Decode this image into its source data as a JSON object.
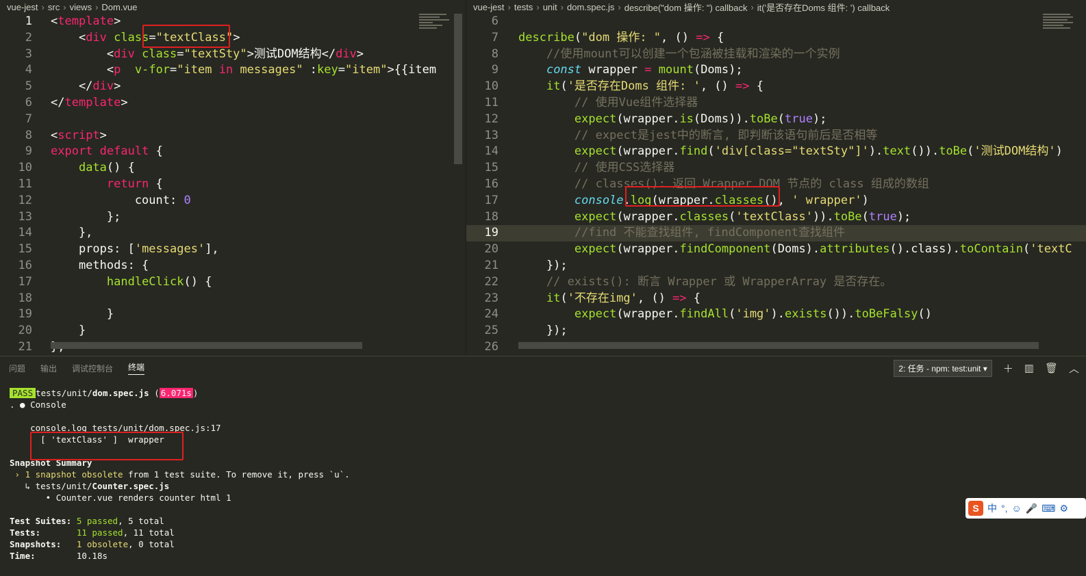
{
  "left_editor": {
    "breadcrumb": [
      "vue-jest",
      "src",
      "views",
      "Dom.vue"
    ],
    "lines": [
      {
        "n": "1",
        "cur": true,
        "parts": [
          [
            "pun",
            "<"
          ],
          [
            "tag",
            "template"
          ],
          [
            "pun",
            ">"
          ]
        ]
      },
      {
        "n": "2",
        "parts": [
          [
            "pun",
            "    <"
          ],
          [
            "tag",
            "div"
          ],
          [
            "pun",
            " "
          ],
          [
            "att",
            "class"
          ],
          [
            "pun",
            "="
          ],
          [
            "str",
            "\"textClass\""
          ],
          [
            "pun",
            ">"
          ]
        ]
      },
      {
        "n": "3",
        "parts": [
          [
            "pun",
            "        <"
          ],
          [
            "tag",
            "div"
          ],
          [
            "pun",
            " "
          ],
          [
            "att",
            "class"
          ],
          [
            "pun",
            "="
          ],
          [
            "str",
            "\"textSty\""
          ],
          [
            "pun",
            ">测试DOM结构</"
          ],
          [
            "tag",
            "div"
          ],
          [
            "pun",
            ">"
          ]
        ]
      },
      {
        "n": "4",
        "parts": [
          [
            "pun",
            "        <"
          ],
          [
            "tag",
            "p"
          ],
          [
            "pun",
            "  "
          ],
          [
            "att",
            "v-for"
          ],
          [
            "pun",
            "="
          ],
          [
            "str",
            "\"item "
          ],
          [
            "kw",
            "in"
          ],
          [
            "str",
            " messages\""
          ],
          [
            "pun",
            " :"
          ],
          [
            "att",
            "key"
          ],
          [
            "pun",
            "="
          ],
          [
            "str",
            "\"item\""
          ],
          [
            "pun",
            ">{{item"
          ]
        ]
      },
      {
        "n": "5",
        "parts": [
          [
            "pun",
            "    </"
          ],
          [
            "tag",
            "div"
          ],
          [
            "pun",
            ">"
          ]
        ]
      },
      {
        "n": "6",
        "parts": [
          [
            "pun",
            "</"
          ],
          [
            "tag",
            "template"
          ],
          [
            "pun",
            ">"
          ]
        ]
      },
      {
        "n": "7",
        "parts": []
      },
      {
        "n": "8",
        "parts": [
          [
            "pun",
            "<"
          ],
          [
            "tag",
            "script"
          ],
          [
            "pun",
            ">"
          ]
        ]
      },
      {
        "n": "9",
        "parts": [
          [
            "kw",
            "export"
          ],
          [
            "pun",
            " "
          ],
          [
            "kw",
            "default"
          ],
          [
            "pun",
            " {"
          ]
        ]
      },
      {
        "n": "10",
        "parts": [
          [
            "pun",
            "    "
          ],
          [
            "fn",
            "data"
          ],
          [
            "pun",
            "() {"
          ]
        ]
      },
      {
        "n": "11",
        "parts": [
          [
            "pun",
            "        "
          ],
          [
            "kw",
            "return"
          ],
          [
            "pun",
            " {"
          ]
        ]
      },
      {
        "n": "12",
        "parts": [
          [
            "pun",
            "            count: "
          ],
          [
            "num",
            "0"
          ]
        ]
      },
      {
        "n": "13",
        "parts": [
          [
            "pun",
            "        };"
          ]
        ]
      },
      {
        "n": "14",
        "parts": [
          [
            "pun",
            "    },"
          ]
        ]
      },
      {
        "n": "15",
        "parts": [
          [
            "pun",
            "    props: ["
          ],
          [
            "str",
            "'messages'"
          ],
          [
            "pun",
            "],"
          ]
        ]
      },
      {
        "n": "16",
        "parts": [
          [
            "pun",
            "    methods: {"
          ]
        ]
      },
      {
        "n": "17",
        "parts": [
          [
            "pun",
            "        "
          ],
          [
            "fn",
            "handleClick"
          ],
          [
            "pun",
            "() {"
          ]
        ]
      },
      {
        "n": "18",
        "parts": []
      },
      {
        "n": "19",
        "parts": [
          [
            "pun",
            "        }"
          ]
        ]
      },
      {
        "n": "20",
        "parts": [
          [
            "pun",
            "    }"
          ]
        ]
      },
      {
        "n": "21",
        "parts": [
          [
            "pun",
            "};"
          ]
        ]
      }
    ]
  },
  "right_editor": {
    "breadcrumb": [
      "vue-jest",
      "tests",
      "unit",
      "dom.spec.js",
      "describe(\"dom 操作: \") callback",
      "it('是否存在Doms 组件: ') callback"
    ],
    "lines": [
      {
        "n": "6",
        "parts": []
      },
      {
        "n": "7",
        "parts": [
          [
            "fn",
            "describe"
          ],
          [
            "pun",
            "("
          ],
          [
            "str",
            "\"dom 操作: \""
          ],
          [
            "pun",
            ", () "
          ],
          [
            "kw",
            "=>"
          ],
          [
            "pun",
            " {"
          ]
        ]
      },
      {
        "n": "8",
        "parts": [
          [
            "cm",
            "    //使用mount可以创建一个包涵被挂载和渲染的一个实例"
          ]
        ]
      },
      {
        "n": "9",
        "parts": [
          [
            "pun",
            "    "
          ],
          [
            "it",
            "const"
          ],
          [
            "pun",
            " wrapper "
          ],
          [
            "kw",
            "="
          ],
          [
            "pun",
            " "
          ],
          [
            "fn",
            "mount"
          ],
          [
            "pun",
            "(Doms);"
          ]
        ]
      },
      {
        "n": "10",
        "parts": [
          [
            "pun",
            "    "
          ],
          [
            "fn",
            "it"
          ],
          [
            "pun",
            "("
          ],
          [
            "str",
            "'是否存在Doms 组件: '"
          ],
          [
            "pun",
            ", () "
          ],
          [
            "kw",
            "=>"
          ],
          [
            "pun",
            " {"
          ]
        ]
      },
      {
        "n": "11",
        "parts": [
          [
            "cm",
            "        // 使用Vue组件选择器"
          ]
        ]
      },
      {
        "n": "12",
        "parts": [
          [
            "pun",
            "        "
          ],
          [
            "fn",
            "expect"
          ],
          [
            "pun",
            "(wrapper."
          ],
          [
            "fn",
            "is"
          ],
          [
            "pun",
            "(Doms))."
          ],
          [
            "fn",
            "toBe"
          ],
          [
            "pun",
            "("
          ],
          [
            "bool",
            "true"
          ],
          [
            "pun",
            ");"
          ]
        ]
      },
      {
        "n": "13",
        "parts": [
          [
            "cm",
            "        // expect是jest中的断言, 即判断该语句前后是否相等"
          ]
        ]
      },
      {
        "n": "14",
        "parts": [
          [
            "pun",
            "        "
          ],
          [
            "fn",
            "expect"
          ],
          [
            "pun",
            "(wrapper."
          ],
          [
            "fn",
            "find"
          ],
          [
            "pun",
            "("
          ],
          [
            "str",
            "'div[class=\"textSty\"]'"
          ],
          [
            "pun",
            ")."
          ],
          [
            "fn",
            "text"
          ],
          [
            "pun",
            "())."
          ],
          [
            "fn",
            "toBe"
          ],
          [
            "pun",
            "("
          ],
          [
            "str",
            "'测试DOM结构'"
          ],
          [
            "pun",
            ")"
          ]
        ]
      },
      {
        "n": "15",
        "parts": [
          [
            "cm",
            "        // 使用CSS选择器"
          ]
        ]
      },
      {
        "n": "16",
        "parts": [
          [
            "cm",
            "        // classes(): 返回 Wrapper DOM 节点的 class 组成的数组"
          ]
        ]
      },
      {
        "n": "17",
        "parts": [
          [
            "pun",
            "        "
          ],
          [
            "it",
            "console"
          ],
          [
            "pun",
            "."
          ],
          [
            "fn",
            "log"
          ],
          [
            "pun",
            "(wrapper."
          ],
          [
            "fn",
            "classes"
          ],
          [
            "pun",
            "(), "
          ],
          [
            "str",
            "' wrapper'"
          ],
          [
            "pun",
            ")"
          ]
        ]
      },
      {
        "n": "18",
        "parts": [
          [
            "pun",
            "        "
          ],
          [
            "fn",
            "expect"
          ],
          [
            "pun",
            "(wrapper."
          ],
          [
            "fn",
            "classes"
          ],
          [
            "pun",
            "("
          ],
          [
            "str",
            "'textClass'"
          ],
          [
            "pun",
            "))."
          ],
          [
            "fn",
            "toBe"
          ],
          [
            "pun",
            "("
          ],
          [
            "bool",
            "true"
          ],
          [
            "pun",
            ");"
          ]
        ]
      },
      {
        "n": "19",
        "cur": true,
        "parts": [
          [
            "cm",
            "        //find 不能查找组件, findComponent查找组件"
          ]
        ]
      },
      {
        "n": "20",
        "parts": [
          [
            "pun",
            "        "
          ],
          [
            "fn",
            "expect"
          ],
          [
            "pun",
            "(wrapper."
          ],
          [
            "fn",
            "findComponent"
          ],
          [
            "pun",
            "(Doms)."
          ],
          [
            "fn",
            "attributes"
          ],
          [
            "pun",
            "().class)."
          ],
          [
            "fn",
            "toContain"
          ],
          [
            "pun",
            "("
          ],
          [
            "str",
            "'textC"
          ]
        ]
      },
      {
        "n": "21",
        "parts": [
          [
            "pun",
            "    });"
          ]
        ]
      },
      {
        "n": "22",
        "parts": [
          [
            "cm",
            "    // exists(): 断言 Wrapper 或 WrapperArray 是否存在。"
          ]
        ]
      },
      {
        "n": "23",
        "parts": [
          [
            "pun",
            "    "
          ],
          [
            "fn",
            "it"
          ],
          [
            "pun",
            "("
          ],
          [
            "str",
            "'不存在img'"
          ],
          [
            "pun",
            ", () "
          ],
          [
            "kw",
            "=>"
          ],
          [
            "pun",
            " {"
          ]
        ]
      },
      {
        "n": "24",
        "parts": [
          [
            "pun",
            "        "
          ],
          [
            "fn",
            "expect"
          ],
          [
            "pun",
            "(wrapper."
          ],
          [
            "fn",
            "findAll"
          ],
          [
            "pun",
            "("
          ],
          [
            "str",
            "'img'"
          ],
          [
            "pun",
            ")."
          ],
          [
            "fn",
            "exists"
          ],
          [
            "pun",
            "())."
          ],
          [
            "fn",
            "toBeFalsy"
          ],
          [
            "pun",
            "()"
          ]
        ]
      },
      {
        "n": "25",
        "parts": [
          [
            "pun",
            "    });"
          ]
        ]
      },
      {
        "n": "26",
        "parts": []
      }
    ]
  },
  "panel": {
    "tabs": [
      "问题",
      "输出",
      "调试控制台",
      "终端"
    ],
    "active_tab": "终端",
    "task_select": "2: 任务 - npm: test:unit",
    "terminal": [
      [
        [
          "pass",
          "PASS"
        ],
        [
          "",
          "tests/unit/"
        ],
        [
          "b",
          "dom.spec.js"
        ],
        [
          "",
          " ("
        ],
        [
          "time",
          "6.071s"
        ],
        [
          "",
          ")"
        ]
      ],
      [
        [
          "",
          ". ● Console"
        ]
      ],
      [
        [
          "",
          ""
        ]
      ],
      [
        [
          "",
          "    console.log tests/unit/dom.spec.js:17"
        ]
      ],
      [
        [
          "",
          "      [ 'textClass' ]  wrapper"
        ]
      ],
      [
        [
          "",
          ""
        ]
      ],
      [
        [
          "b",
          "Snapshot Summary"
        ]
      ],
      [
        [
          "y",
          " › 1 snapshot obsolete"
        ],
        [
          "",
          " from 1 test suite. To remove it, press `u`."
        ]
      ],
      [
        [
          "",
          "   ↳ tests/unit/"
        ],
        [
          "b",
          "Counter.spec.js"
        ]
      ],
      [
        [
          "",
          "       • Counter.vue renders counter html 1"
        ]
      ],
      [
        [
          "",
          ""
        ]
      ],
      [
        [
          "b",
          "Test Suites: "
        ],
        [
          "g",
          "5 passed"
        ],
        [
          "",
          ", 5 total"
        ]
      ],
      [
        [
          "b",
          "Tests:       "
        ],
        [
          "g",
          "11 passed"
        ],
        [
          "",
          ", 11 total"
        ]
      ],
      [
        [
          "b",
          "Snapshots:   "
        ],
        [
          "y",
          "1 obsolete"
        ],
        [
          "",
          ", 0 total"
        ]
      ],
      [
        [
          "b",
          "Time:        "
        ],
        [
          "",
          "10.18s"
        ]
      ]
    ]
  },
  "ime": {
    "label": "中"
  },
  "colors": {
    "bg": "#272822",
    "accent_pass": "#a6e22e",
    "accent_time": "#f92672",
    "highlight": "#e02020"
  }
}
